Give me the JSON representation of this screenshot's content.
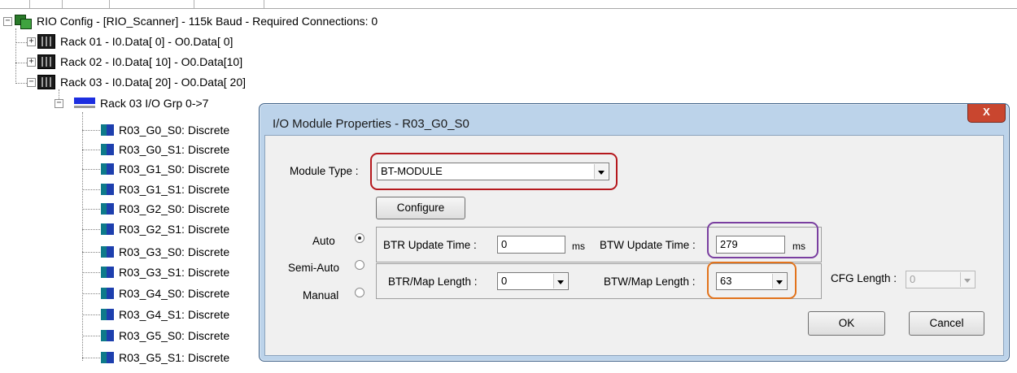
{
  "tree": {
    "root": "RIO Config - [RIO_Scanner] - 115k Baud - Required Connections: 0",
    "racks": [
      "Rack 01 - I0.Data[ 0] - O0.Data[ 0]",
      "Rack 02 - I0.Data[ 10] - O0.Data[10]",
      "Rack 03 - I0.Data[ 20] - O0.Data[ 20]"
    ],
    "group": "Rack 03 I/O Grp 0->7",
    "modules": [
      "R03_G0_S0: Discrete",
      "R03_G0_S1: Discrete",
      "R03_G1_S0: Discrete",
      "R03_G1_S1: Discrete",
      "R03_G2_S0: Discrete",
      "R03_G2_S1: Discrete",
      "R03_G3_S0: Discrete",
      "R03_G3_S1: Discrete",
      "R03_G4_S0: Discrete",
      "R03_G4_S1: Discrete",
      "R03_G5_S0: Discrete",
      "R03_G5_S1: Discrete"
    ]
  },
  "dialog": {
    "title": "I/O Module Properties - R03_G0_S0",
    "close": "X",
    "module_type_label": "Module Type :",
    "module_type_value": "BT-MODULE",
    "configure": "Configure",
    "modes": {
      "auto": "Auto",
      "semi": "Semi-Auto",
      "manual": "Manual"
    },
    "btr_update_label": "BTR Update Time :",
    "btr_update_value": "0",
    "btr_update_unit": "ms",
    "btw_update_label": "BTW Update Time :",
    "btw_update_value": "279",
    "btw_update_unit": "ms",
    "btr_map_label": "BTR/Map Length :",
    "btr_map_value": "0",
    "btw_map_label": "BTW/Map Length :",
    "btw_map_value": "63",
    "cfg_label": "CFG Length :",
    "cfg_value": "0",
    "ok": "OK",
    "cancel": "Cancel"
  },
  "colors": {
    "highlight_module_type": "#b5181d",
    "highlight_btw_update": "#7a3fa0",
    "highlight_btw_map": "#e2731c"
  }
}
